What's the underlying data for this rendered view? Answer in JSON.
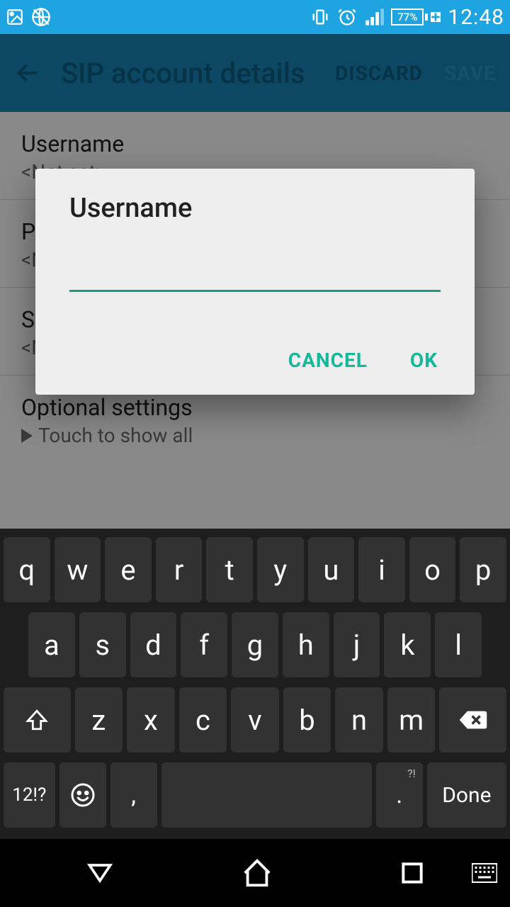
{
  "status": {
    "battery": "77%",
    "time": "12:48"
  },
  "appbar": {
    "title": "SIP account details",
    "discard": "DISCARD",
    "save": "SAVE"
  },
  "settings": {
    "username_label": "Username",
    "username_value": "<Not set>",
    "password_label": "Password",
    "password_value": "<Not set>",
    "server_label": "Server",
    "server_value": "<Not set>",
    "optional_label": "Optional settings",
    "optional_value": "Touch to show all"
  },
  "dialog": {
    "title": "Username",
    "input_value": "",
    "cancel": "CANCEL",
    "ok": "OK"
  },
  "keyboard": {
    "row1": [
      "q",
      "w",
      "e",
      "r",
      "t",
      "y",
      "u",
      "i",
      "o",
      "p"
    ],
    "row2": [
      "a",
      "s",
      "d",
      "f",
      "g",
      "h",
      "j",
      "k",
      "l"
    ],
    "row3": [
      "z",
      "x",
      "c",
      "v",
      "b",
      "n",
      "m"
    ],
    "sym": "12!?",
    "comma": ",",
    "period": ".",
    "period_sup": "?!",
    "done": "Done"
  }
}
